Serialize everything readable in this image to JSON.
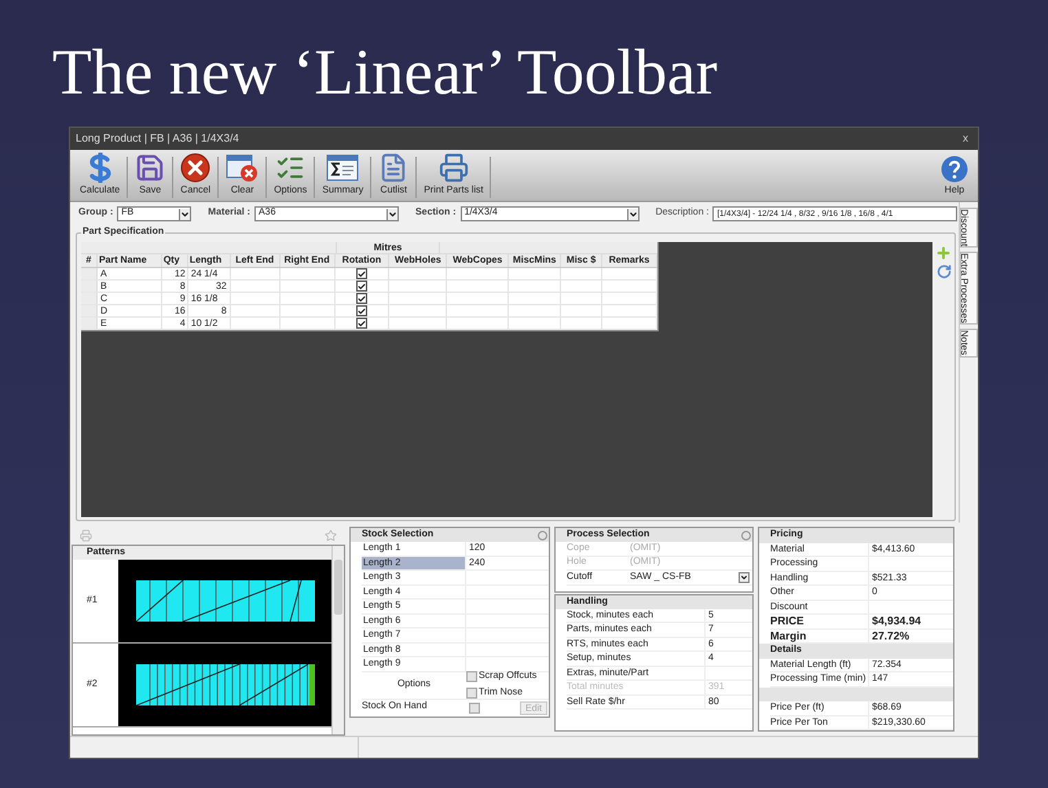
{
  "slide_title": "The new ‘Linear’ Toolbar",
  "window": {
    "title": "Long Product | FB | A36 | 1/4X3/4",
    "close": "x"
  },
  "toolbar": [
    {
      "kind": "calculate",
      "label": "Calculate"
    },
    {
      "kind": "save",
      "label": "Save"
    },
    {
      "kind": "cancel",
      "label": "Cancel"
    },
    {
      "kind": "clear",
      "label": "Clear"
    },
    {
      "kind": "options",
      "label": "Options"
    },
    {
      "kind": "summary",
      "label": "Summary"
    },
    {
      "kind": "cutlist",
      "label": "Cutlist"
    },
    {
      "kind": "print",
      "label": "Print Parts list"
    }
  ],
  "help": {
    "label": "Help"
  },
  "filters": [
    {
      "kind": "dropdown",
      "label": "Group :",
      "value": "FB"
    },
    {
      "kind": "dropdown",
      "label": "Material :",
      "value": "A36"
    },
    {
      "kind": "dropdown",
      "label": "Section :",
      "value": "1/4X3/4"
    },
    {
      "kind": "text",
      "label": "Description :",
      "value": "[1/4X3/4] -  12/24 1/4 , 8/32 , 9/16 1/8 , 16/8 , 4/1"
    }
  ],
  "part_spec": {
    "title": "Part Specification",
    "group_header": "Mitres",
    "columns": [
      "#",
      "Part Name",
      "Qty",
      "Length",
      "Left End",
      "Right End",
      "Rotation",
      "WebHoles",
      "WebCopes",
      "MiscMins",
      "Misc $",
      "Remarks"
    ],
    "rows": [
      {
        "name": "A",
        "qty": "12",
        "length": "24 1/4",
        "rotation": true
      },
      {
        "name": "B",
        "qty": "8",
        "length": "32",
        "rotation": true
      },
      {
        "name": "C",
        "qty": "9",
        "length": "16 1/8",
        "rotation": true
      },
      {
        "name": "D",
        "qty": "16",
        "length": "8",
        "rotation": true
      },
      {
        "name": "E",
        "qty": "4",
        "length": "10 1/2",
        "rotation": true
      }
    ]
  },
  "side_tabs": [
    "Discount",
    "Extra Processes",
    "Notes"
  ],
  "patterns": {
    "title": "Patterns",
    "items": [
      "#1",
      "#2"
    ]
  },
  "stock_selection": {
    "title": "Stock Selection",
    "rows": [
      {
        "label": "Length 1",
        "value": "120",
        "selected": false
      },
      {
        "label": "Length 2",
        "value": "240",
        "selected": true
      },
      {
        "label": "Length 3",
        "selected": false
      },
      {
        "label": "Length 4",
        "selected": false
      },
      {
        "label": "Length 5",
        "selected": false
      },
      {
        "label": "Length 6",
        "selected": false
      },
      {
        "label": "Length 7",
        "selected": false
      },
      {
        "label": "Length 8",
        "selected": false
      },
      {
        "label": "Length 9",
        "selected": false
      }
    ],
    "options_label": "Options",
    "options": [
      {
        "label": "Scrap Offcuts",
        "checked": false
      },
      {
        "label": "Trim Nose",
        "checked": false
      }
    ],
    "stock_on_hand": {
      "label": "Stock On Hand",
      "checked": false,
      "button": "Edit",
      "button_disabled": true
    }
  },
  "process_selection": {
    "title": "Process Selection",
    "rows": [
      {
        "label": "Cope",
        "value": "(OMIT)",
        "disabled": true
      },
      {
        "label": "Hole",
        "value": "(OMIT)",
        "disabled": true
      },
      {
        "label": "Cutoff",
        "value": "SAW _ CS-FB",
        "disabled": false
      }
    ]
  },
  "handling": {
    "title": "Handling",
    "rows": [
      {
        "label": "Stock, minutes each",
        "value": "5",
        "disabled": false
      },
      {
        "label": "Parts, minutes each",
        "value": "7",
        "disabled": false
      },
      {
        "label": "RTS, minutes each",
        "value": "6",
        "disabled": false
      },
      {
        "label": "Setup, minutes",
        "value": "4",
        "disabled": false
      },
      {
        "label": "Extras, minute/Part",
        "disabled": false
      },
      {
        "label": "Total minutes",
        "value": "391",
        "disabled": true
      },
      {
        "label": "Sell Rate $/hr",
        "value": "80",
        "disabled": false
      }
    ]
  },
  "pricing": [
    {
      "kind": "header",
      "label": "Pricing"
    },
    {
      "kind": "row",
      "label": "Material",
      "value": "$4,413.60",
      "bold": false
    },
    {
      "kind": "row",
      "label": "Processing",
      "bold": false
    },
    {
      "kind": "row",
      "label": "Handling",
      "value": "$521.33",
      "bold": false
    },
    {
      "kind": "row",
      "label": "Other",
      "value": "0",
      "bold": false
    },
    {
      "kind": "row",
      "label": "Discount",
      "bold": false
    },
    {
      "kind": "row",
      "label": "PRICE",
      "value": "$4,934.94",
      "bold": true
    },
    {
      "kind": "row",
      "label": "Margin",
      "value": "27.72%",
      "bold": true
    },
    {
      "kind": "header",
      "label": "Details"
    },
    {
      "kind": "row",
      "label": "Material Length (ft)",
      "value": "72.354",
      "bold": false
    },
    {
      "kind": "row",
      "label": "Processing Time (min)",
      "value": "147",
      "bold": false
    },
    {
      "kind": "spacer"
    },
    {
      "kind": "row",
      "label": "Price Per (ft)",
      "value": "$68.69",
      "bold": false
    },
    {
      "kind": "row",
      "label": "Price Per Ton",
      "value": "$219,330.60",
      "bold": false
    }
  ]
}
